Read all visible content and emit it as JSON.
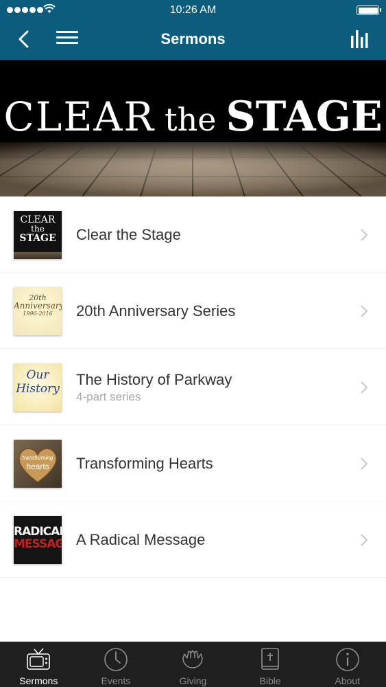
{
  "status_bar": {
    "time": "10:26 AM"
  },
  "nav_bar": {
    "title": "Sermons"
  },
  "banner": {
    "word1": "CLEAR",
    "word2": "the",
    "word3": "STAGE"
  },
  "sermons": [
    {
      "title": "Clear the Stage",
      "subtitle": "",
      "thumb": {
        "line1": "CLEAR",
        "line2": "the",
        "line3": "STAGE"
      }
    },
    {
      "title": "20th Anniversary Series",
      "subtitle": "",
      "thumb": {
        "line1": "20th",
        "line2": "Anniversary",
        "line3": "1996-2016"
      }
    },
    {
      "title": "The History of Parkway",
      "subtitle": "4-part series",
      "thumb": {
        "line1": "Our",
        "line2": "History"
      }
    },
    {
      "title": "Transforming Hearts",
      "subtitle": "",
      "thumb": {
        "line1": "transforming",
        "line2": "hearts"
      }
    },
    {
      "title": "A Radical Message",
      "subtitle": "",
      "thumb": {
        "line1": "RADICAL",
        "line2": "MESSAGE"
      }
    }
  ],
  "tabs": [
    {
      "label": "Sermons",
      "icon": "tv-icon",
      "active": true
    },
    {
      "label": "Events",
      "icon": "clock-icon",
      "active": false
    },
    {
      "label": "Giving",
      "icon": "praying-hands-icon",
      "active": false
    },
    {
      "label": "Bible",
      "icon": "bible-icon",
      "active": false
    },
    {
      "label": "About",
      "icon": "info-icon",
      "active": false
    }
  ],
  "colors": {
    "nav_bar": "#0d5c7e",
    "tab_bar": "#1f1f1f",
    "tab_active": "#ffffff",
    "tab_inactive": "#8f8f8f"
  }
}
